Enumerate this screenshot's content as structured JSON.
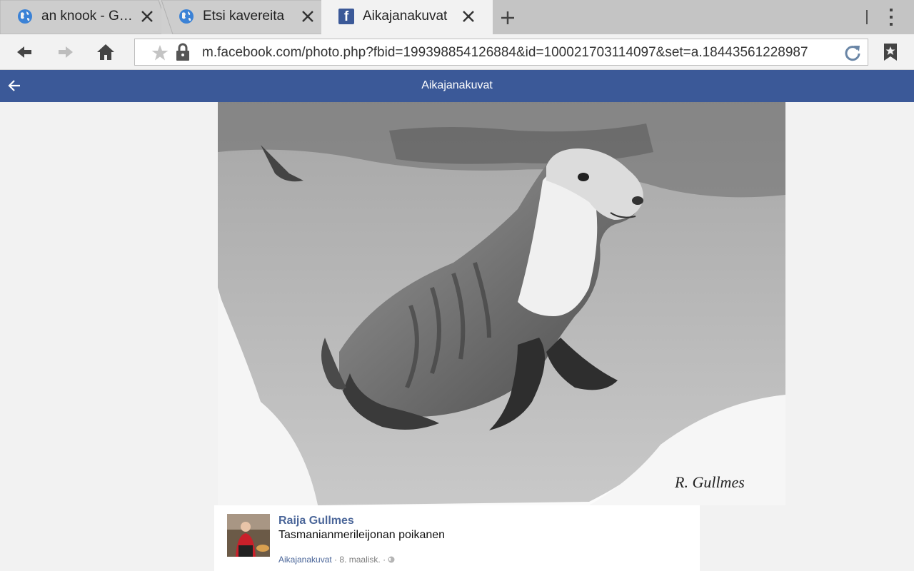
{
  "tabs": [
    {
      "title": "an knook - G…",
      "icon": "globe-icon",
      "active": false
    },
    {
      "title": "Etsi kavereita",
      "icon": "globe-icon",
      "active": false
    },
    {
      "title": "Aikajanakuvat",
      "icon": "facebook-icon",
      "active": true
    }
  ],
  "address_bar": {
    "url": "m.facebook.com/photo.php?fbid=199398854126884&id=100021703114097&set=a.18443561228987"
  },
  "fb_header": {
    "title": "Aikajanakuvat"
  },
  "photo": {
    "signature": "R. Gullmes",
    "description": "pencil drawing of a young sea lion on rocks"
  },
  "post": {
    "author": "Raija Gullmes",
    "caption": "Tasmanianmerileijonan poikanen",
    "album": "Aikajanakuvat",
    "separator": " · ",
    "date": "8. maalisk.",
    "privacy_icon": "globe-icon"
  },
  "colors": {
    "facebook_blue": "#3b5998",
    "link_blue": "#4b6699"
  }
}
